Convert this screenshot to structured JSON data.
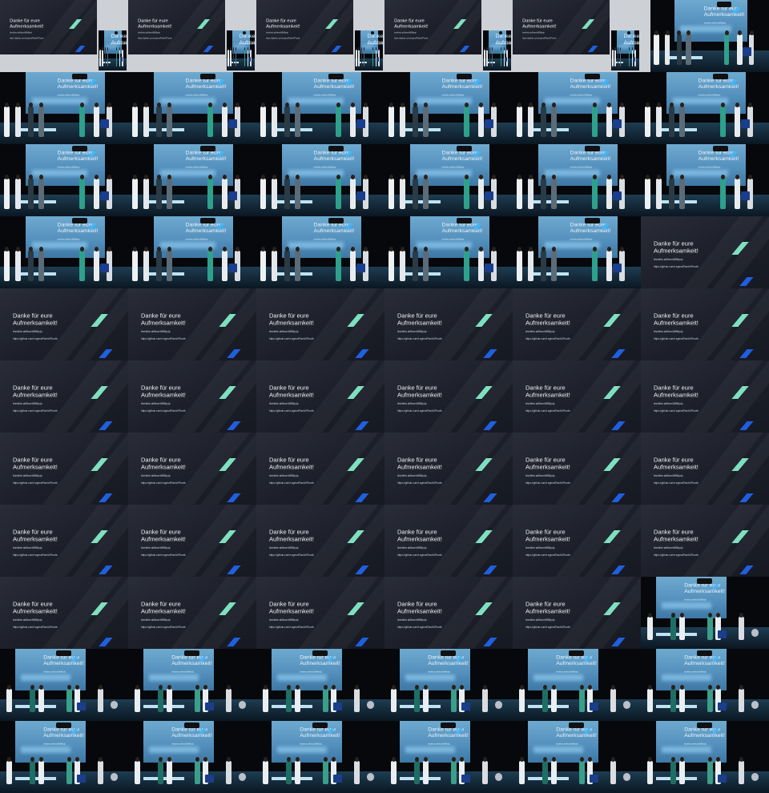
{
  "contact_sheet": {
    "columns": 6,
    "rows": 11,
    "frames": [
      "slide-thumb",
      "slide-thumb",
      "slide-thumb",
      "slide-thumb",
      "slide-thumb",
      "stage-wide",
      "stage",
      "stage",
      "stage",
      "stage",
      "stage",
      "stage",
      "stage",
      "stage",
      "stage",
      "stage",
      "stage",
      "stage",
      "stage",
      "stage",
      "stage",
      "stage",
      "stage",
      "slide",
      "slide",
      "slide",
      "slide",
      "slide",
      "slide",
      "slide",
      "slide",
      "slide",
      "slide",
      "slide",
      "slide",
      "slide",
      "slide",
      "slide",
      "slide",
      "slide",
      "slide",
      "slide",
      "slide",
      "slide",
      "slide",
      "slide",
      "slide",
      "slide",
      "slide",
      "slide",
      "slide",
      "slide",
      "slide",
      "stage-far",
      "stage-far",
      "stage-far",
      "stage-far",
      "stage-far",
      "stage-far",
      "stage-far",
      "stage-far",
      "stage-far",
      "stage-far",
      "stage-far",
      "stage-far",
      "stage-far"
    ]
  },
  "slide": {
    "title": "Danke für eure\nAufmerksamkeit!",
    "link_1": "tinnitinte.at/ttkon/tt898pdp",
    "link_2": "https://github.com/LegendFlashXFhurtb"
  },
  "colors": {
    "slide_bg": "#1e2029",
    "accent_teal": "#7ee0c0",
    "accent_blue": "#1f5fe0",
    "stage_screen": "#5a95c2",
    "letterbox_gray": "#cdd0d5",
    "background": "#0b0d12"
  }
}
